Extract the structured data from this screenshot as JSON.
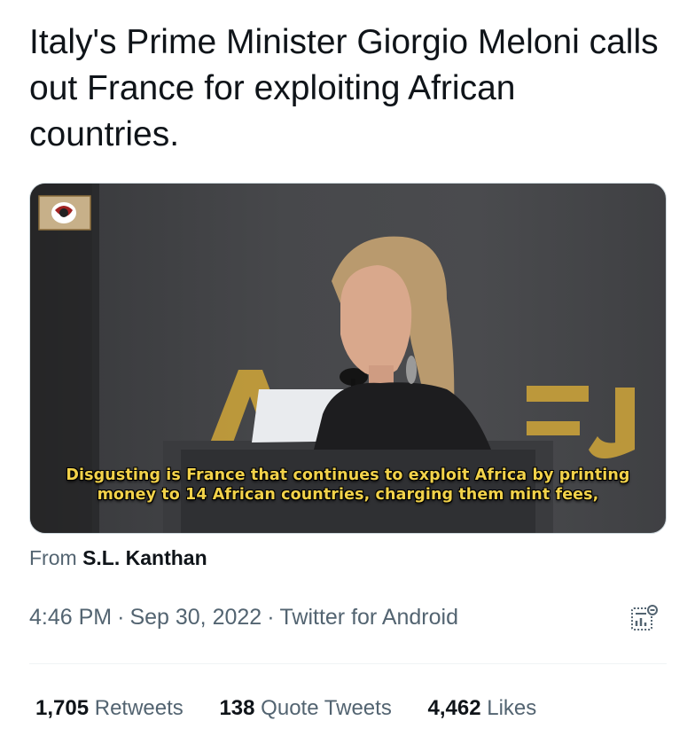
{
  "tweet": {
    "text": "Italy's Prime Minister Giorgio Meloni calls out France for exploiting African countries."
  },
  "media": {
    "subtitle_line1": "Disgusting is France that continues to exploit Africa by printing",
    "subtitle_line2": "money to 14 African countries, charging them mint fees,",
    "backdrop_letters": "A  E  J"
  },
  "source": {
    "prefix": "From",
    "name": "S.L. Kanthan"
  },
  "meta": {
    "time": "4:46 PM",
    "separator": "·",
    "date": "Sep 30, 2022",
    "client": "Twitter for Android",
    "analytics_icon": "analytics-icon"
  },
  "stats": {
    "retweets_count": "1,705",
    "retweets_label": "Retweets",
    "quotes_count": "138",
    "quotes_label": "Quote Tweets",
    "likes_count": "4,462",
    "likes_label": "Likes"
  },
  "colors": {
    "text_primary": "#0f1419",
    "text_secondary": "#536471",
    "subtitle_yellow": "#f2d24a",
    "divider": "#eff3f4"
  }
}
